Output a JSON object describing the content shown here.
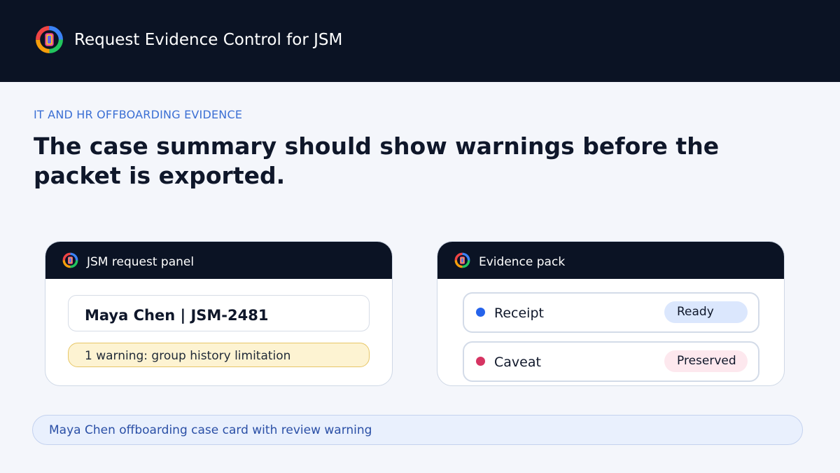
{
  "app": {
    "title": "Request Evidence Control for JSM"
  },
  "hero": {
    "eyebrow": "IT AND HR OFFBOARDING EVIDENCE",
    "headline": "The case summary should show warnings before the packet is exported."
  },
  "request_panel": {
    "title": "JSM request panel",
    "case_label": "Maya Chen | JSM-2481",
    "warning": "1 warning: group history limitation"
  },
  "evidence_pack": {
    "title": "Evidence pack",
    "items": [
      {
        "label": "Receipt",
        "status": "Ready",
        "dot_color": "#2563eb",
        "pill_bg": "#dbe7fd"
      },
      {
        "label": "Caveat",
        "status": "Preserved",
        "dot_color": "#d63462",
        "pill_bg": "#fde8ee"
      }
    ]
  },
  "caption": "Maya Chen offboarding case card with review warning",
  "colors": {
    "header_bg": "#0b1324",
    "accent_blue": "#3b6fd4",
    "warning_bg": "#fdf3d2"
  },
  "icons": {
    "brand": "ring-logo-icon"
  }
}
